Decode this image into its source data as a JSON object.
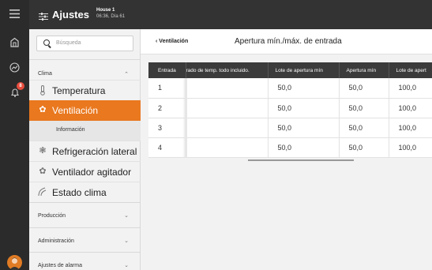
{
  "topbar": {
    "title": "Ajustes",
    "house_name": "House 1",
    "house_time": "06:36, Día 61"
  },
  "rail": {
    "alarm_count": "8",
    "icons": [
      "menu-icon",
      "house-icon",
      "graph-icon",
      "bell-icon",
      "avatar"
    ]
  },
  "sidebar": {
    "search_placeholder": "Búsqueda",
    "clima_label": "Clima",
    "items": [
      {
        "label": "Temperatura",
        "icon": "thermometer-icon"
      },
      {
        "label": "Ventilación",
        "icon": "fan-icon",
        "active": true
      },
      {
        "label": "Refrigeración lateral",
        "icon": "cooling-icon"
      },
      {
        "label": "Ventilador agitador",
        "icon": "fan-icon"
      },
      {
        "label": "Estado clima",
        "icon": "climate-icon"
      }
    ],
    "subitem": "Información",
    "sections": [
      "Producción",
      "Administración",
      "Ajustes de alarma"
    ]
  },
  "main": {
    "back_label": "Ventilación",
    "page_title": "Apertura mín./máx. de entrada",
    "columns": [
      "Entrada",
      "rado de temp. todo incluido.",
      "Lote de apertura mín",
      "Apertura mín",
      "Lote de apert"
    ],
    "rows": [
      [
        "1",
        "",
        "50,0",
        "50,0",
        "100,0"
      ],
      [
        "2",
        "",
        "50,0",
        "50,0",
        "100,0"
      ],
      [
        "3",
        "",
        "50,0",
        "50,0",
        "100,0"
      ],
      [
        "4",
        "",
        "50,0",
        "50,0",
        "100,0"
      ]
    ]
  },
  "colors": {
    "accent": "#e9781f",
    "topbar": "#333333",
    "rail": "#2b2b2b",
    "badge": "#e74c3c"
  }
}
